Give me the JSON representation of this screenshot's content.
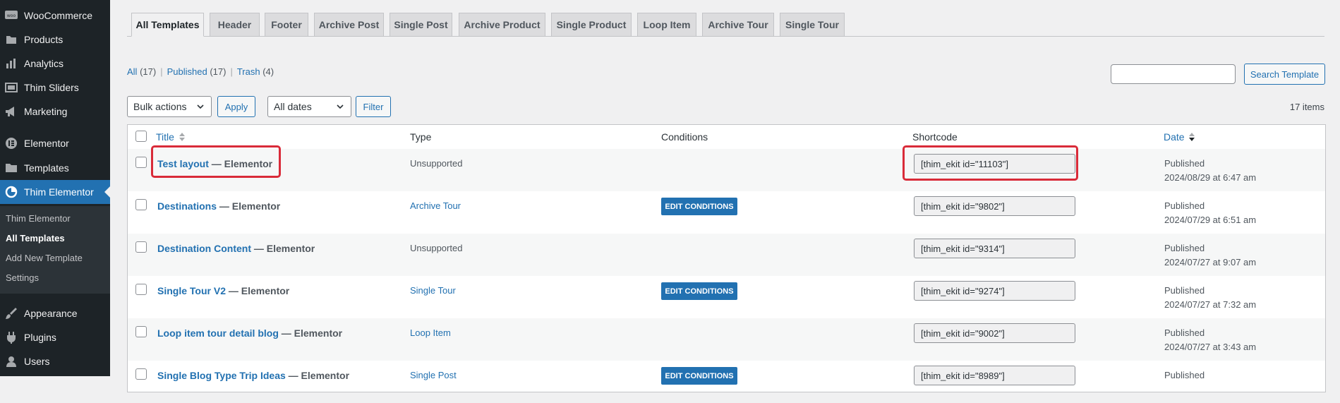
{
  "sidebar": {
    "items": [
      {
        "label": "WooCommerce",
        "icon": "woocommerce-icon"
      },
      {
        "label": "Products",
        "icon": "products-icon"
      },
      {
        "label": "Analytics",
        "icon": "analytics-icon"
      },
      {
        "label": "Thim Sliders",
        "icon": "sliders-icon"
      },
      {
        "label": "Marketing",
        "icon": "megaphone-icon"
      },
      {
        "label": "Elementor",
        "icon": "elementor-icon"
      },
      {
        "label": "Templates",
        "icon": "folder-icon"
      },
      {
        "label": "Thim Elementor",
        "icon": "thim-elementor-icon"
      },
      {
        "label": "Appearance",
        "icon": "paintbrush-icon"
      },
      {
        "label": "Plugins",
        "icon": "plugin-icon"
      },
      {
        "label": "Users",
        "icon": "user-icon"
      }
    ],
    "submenu": [
      "Thim Elementor",
      "All Templates",
      "Add New Template",
      "Settings"
    ]
  },
  "tabs": [
    "All Templates",
    "Header",
    "Footer",
    "Archive Post",
    "Single Post",
    "Archive Product",
    "Single Product",
    "Loop Item",
    "Archive Tour",
    "Single Tour"
  ],
  "filters": {
    "all": "All",
    "all_count": "(17)",
    "published": "Published",
    "published_count": "(17)",
    "trash": "Trash",
    "trash_count": "(4)",
    "sep": "|"
  },
  "search": {
    "button": "Search Template",
    "value": ""
  },
  "bulk": {
    "selected": "Bulk actions",
    "apply": "Apply"
  },
  "dates": {
    "selected": "All dates",
    "filter": "Filter"
  },
  "items_count": "17 items",
  "columns": {
    "title": "Title",
    "type": "Type",
    "conditions": "Conditions",
    "shortcode": "Shortcode",
    "date": "Date"
  },
  "rows": [
    {
      "title": "Test layout",
      "suffix": " — Elementor",
      "type": "Unsupported",
      "conditions": "",
      "shortcode": "[thim_ekit id=\"11103\"]",
      "status": "Published",
      "date": "2024/08/29 at 6:47 am"
    },
    {
      "title": "Destinations",
      "suffix": " — Elementor",
      "type": "Archive Tour",
      "conditions": "EDIT CONDITIONS",
      "shortcode": "[thim_ekit id=\"9802\"]",
      "status": "Published",
      "date": "2024/07/29 at 6:51 am"
    },
    {
      "title": "Destination Content",
      "suffix": " — Elementor",
      "type": "Unsupported",
      "conditions": "",
      "shortcode": "[thim_ekit id=\"9314\"]",
      "status": "Published",
      "date": "2024/07/27 at 9:07 am"
    },
    {
      "title": "Single Tour V2",
      "suffix": " — Elementor",
      "type": "Single Tour",
      "conditions": "EDIT CONDITIONS",
      "shortcode": "[thim_ekit id=\"9274\"]",
      "status": "Published",
      "date": "2024/07/27 at 7:32 am"
    },
    {
      "title": "Loop item tour detail blog",
      "suffix": " — Elementor",
      "type": "Loop Item",
      "conditions": "",
      "shortcode": "[thim_ekit id=\"9002\"]",
      "status": "Published",
      "date": "2024/07/27 at 3:43 am"
    },
    {
      "title": "Single Blog Type Trip Ideas",
      "suffix": " — Elementor",
      "type": "Single Post",
      "conditions": "EDIT CONDITIONS",
      "shortcode": "[thim_ekit id=\"8989\"]",
      "status": "Published",
      "date": ""
    }
  ],
  "colors": {
    "sidebar_bg": "#1d2327",
    "accent": "#2271b1",
    "highlight": "#d92b39"
  }
}
